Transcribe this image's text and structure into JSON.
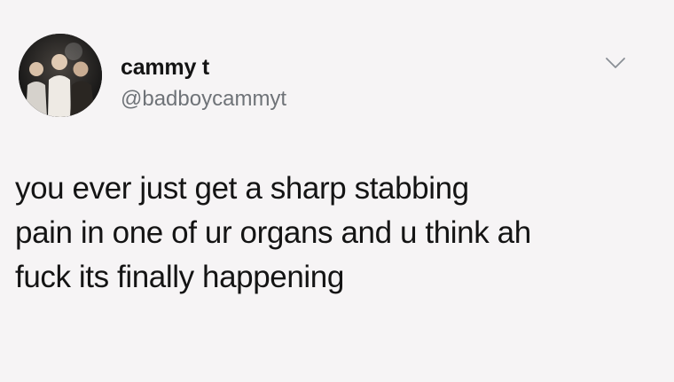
{
  "tweet": {
    "author": {
      "display_name": "cammy t",
      "handle": "@badboycammyt"
    },
    "text": "you ever just get a sharp stabbing\npain in one of ur organs and u think ah\nfuck its finally happening",
    "icons": {
      "avatar": "profile-photo",
      "menu": "chevron-down-icon"
    }
  }
}
